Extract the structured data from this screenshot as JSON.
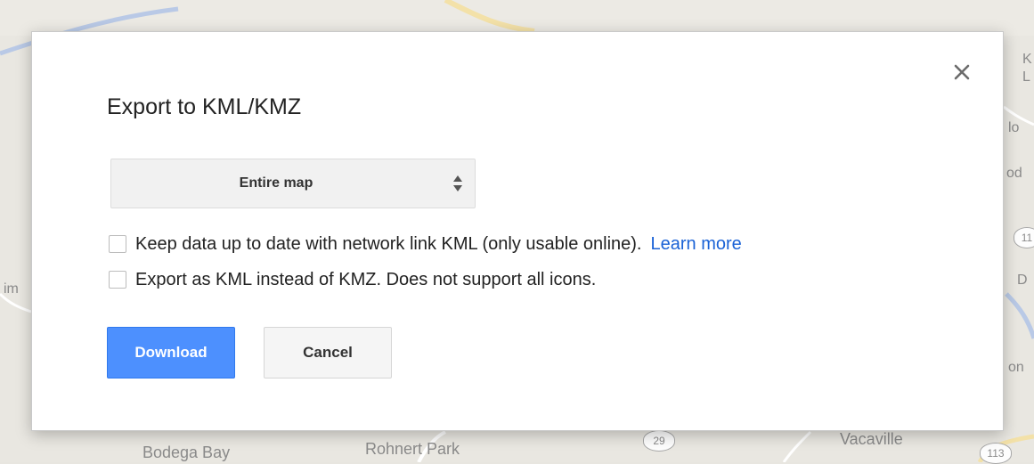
{
  "dialog": {
    "title": "Export to KML/KMZ",
    "close_icon": "close-icon",
    "scope_select": {
      "value": "Entire map",
      "icon": "updown-arrows-icon"
    },
    "options": [
      {
        "label": "Keep data up to date with network link KML (only usable online).",
        "link": "Learn more",
        "checked": false
      },
      {
        "label": "Export as KML instead of KMZ. Does not support all icons.",
        "checked": false
      }
    ],
    "buttons": {
      "download": "Download",
      "cancel": "Cancel"
    },
    "colors": {
      "primary": "#4d90fe",
      "link": "#1a62d6"
    }
  },
  "map": {
    "labels": [
      "Bodega Bay",
      "Rohnert Park",
      "Vacaville"
    ],
    "edge_fragments": [
      "K",
      "L",
      "lo",
      "od",
      "D",
      "on",
      "im"
    ],
    "route_shields": [
      "29",
      "113",
      "11"
    ]
  }
}
